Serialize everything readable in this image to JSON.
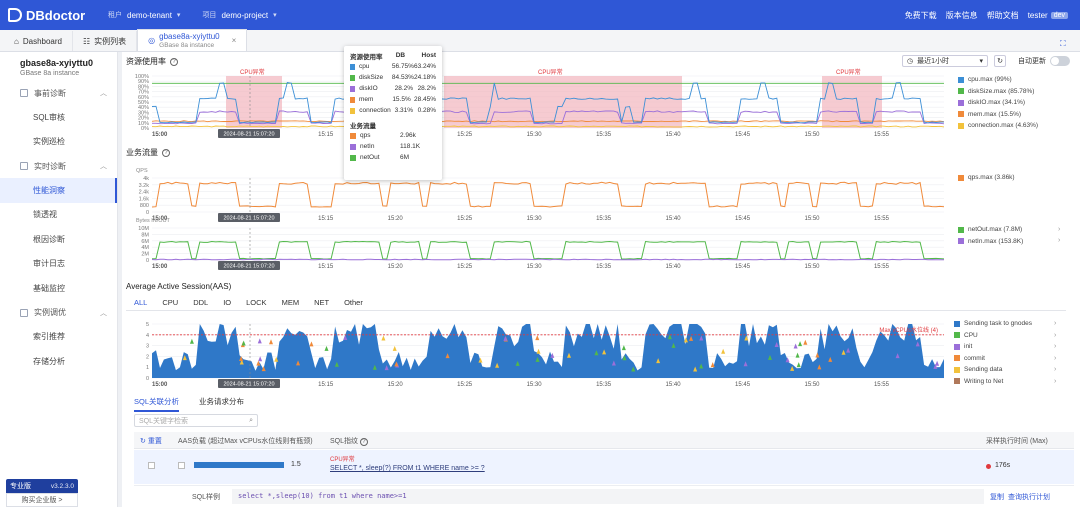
{
  "topbar": {
    "logo_text": "DBdoctor",
    "tenant_key": "租户",
    "tenant_value": "demo-tenant",
    "project_key": "项目",
    "project_value": "demo-project",
    "links": [
      "免费下载",
      "版本信息",
      "帮助文档"
    ],
    "user": "tester",
    "user_badge": "dev"
  },
  "tabs": [
    {
      "label": "Dashboard"
    },
    {
      "label": "实例列表"
    },
    {
      "label": "gbase8a-xyiyttu0",
      "sub": "GBase 8a instance",
      "close": "×"
    }
  ],
  "sidebar": {
    "instance_name": "gbase8a-xyiyttu0",
    "instance_type": "GBase 8a instance",
    "groups": [
      {
        "label": "事前诊断",
        "items": [
          "SQL审核",
          "实例巡检"
        ]
      },
      {
        "label": "实时诊断",
        "items": [
          "性能洞察",
          "锁透视",
          "根因诊断",
          "审计日志",
          "基础监控"
        ]
      },
      {
        "label": "实例调优",
        "items": [
          "索引推荐",
          "存储分析"
        ]
      }
    ],
    "active_item": "性能洞察",
    "edition": "专业版",
    "version": "v3.2.3.0",
    "buy": "购买企业版 >"
  },
  "resource": {
    "title": "资源使用率",
    "time_range": "最近1小时",
    "auto_refresh": "自动更新",
    "anomaly_label": "CPU异常",
    "y_ticks": [
      "100%",
      "90%",
      "80%",
      "70%",
      "60%",
      "50%",
      "40%",
      "30%",
      "20%",
      "10%",
      "0%"
    ],
    "x_ticks": [
      "15:00",
      "15:10",
      "15:15",
      "15:20",
      "15:25",
      "15:30",
      "15:35",
      "15:40",
      "15:45",
      "15:50",
      "15:55"
    ],
    "cursor_time": "2024-08-21 15:07:20",
    "legend": [
      {
        "name": "cpu.max (99%)",
        "color": "#3c8fd6"
      },
      {
        "name": "diskSize.max (85.78%)",
        "color": "#52b84a"
      },
      {
        "name": "diskIO.max (34.1%)",
        "color": "#9b6fd9"
      },
      {
        "name": "mem.max (15.5%)",
        "color": "#f08a3a"
      },
      {
        "name": "connection.max (4.63%)",
        "color": "#f2c23c"
      }
    ]
  },
  "tooltip": {
    "h1": "资源使用率",
    "h2": "DB",
    "h3": "Host",
    "rows": [
      {
        "name": "cpu",
        "db": "56.75%",
        "host": "63.24%",
        "color": "#3c8fd6"
      },
      {
        "name": "diskSize",
        "db": "84.53%",
        "host": "24.18%",
        "color": "#52b84a"
      },
      {
        "name": "diskIO",
        "db": "28.2%",
        "host": "28.2%",
        "color": "#9b6fd9"
      },
      {
        "name": "mem",
        "db": "15.5%",
        "host": "28.45%",
        "color": "#f08a3a"
      },
      {
        "name": "connection",
        "db": "3.31%",
        "host": "0.28%",
        "color": "#f2c23c"
      }
    ],
    "h4": "业务流量",
    "rows2": [
      {
        "name": "qps",
        "v": "2.96k",
        "color": "#f08a3a"
      },
      {
        "name": "netIn",
        "v": "118.1K",
        "color": "#9b6fd9"
      },
      {
        "name": "netOut",
        "v": "6M",
        "color": "#52b84a"
      }
    ]
  },
  "traffic": {
    "title": "业务流量",
    "qps_unit": "QPS",
    "qps_ticks": [
      "4k",
      "3.2k",
      "2.4k",
      "1.6k",
      "800",
      "0"
    ],
    "net_unit": "Bytes IN/OUT",
    "net_ticks": [
      "10M",
      "8M",
      "6M",
      "4M",
      "2M",
      "0"
    ],
    "legend_qps": [
      {
        "name": "qps.max (3.86k)",
        "color": "#f08a3a"
      }
    ],
    "legend_net": [
      {
        "name": "netOut.max (7.8M)",
        "color": "#52b84a"
      },
      {
        "name": "netIn.max (153.8K)",
        "color": "#9b6fd9"
      }
    ]
  },
  "aas": {
    "title": "Average Active Session(AAS)",
    "tabs": [
      "ALL",
      "CPU",
      "DDL",
      "IO",
      "LOCK",
      "MEM",
      "NET",
      "Other"
    ],
    "y_ticks": [
      "5",
      "4",
      "3",
      "2",
      "1",
      "0"
    ],
    "max_label": "Max vCPUs水位线 (4)",
    "legend": [
      {
        "name": "Sending task to gnodes",
        "color": "#2f78c8"
      },
      {
        "name": "CPU",
        "color": "#52b84a"
      },
      {
        "name": "init",
        "color": "#9b6fd9"
      },
      {
        "name": "commit",
        "color": "#f08a3a"
      },
      {
        "name": "Sending data",
        "color": "#f2c23c"
      },
      {
        "name": "Writing to Net",
        "color": "#b0785a"
      }
    ]
  },
  "sql": {
    "tabs": [
      "SQL关联分析",
      "业务请求分布"
    ],
    "search_placeholder": "SQL关键字检索",
    "reset": "重置",
    "col_aas": "AAS负载 (超过Max vCPUs水位线则有瓶颈)",
    "col_sql": "SQL指纹",
    "col_time": "采样执行时间 (Max)",
    "row_value": "1.5",
    "row_tag": "CPU异常",
    "row_sql": "SELECT *, sleep(?) FROM t1 WHERE name >= ?",
    "row_time": "176s",
    "sample_label": "SQL样例",
    "sample_sql": "select *,sleep(10) from t1 where name>=1",
    "copy": "复制",
    "plan": "查询执行计划"
  }
}
